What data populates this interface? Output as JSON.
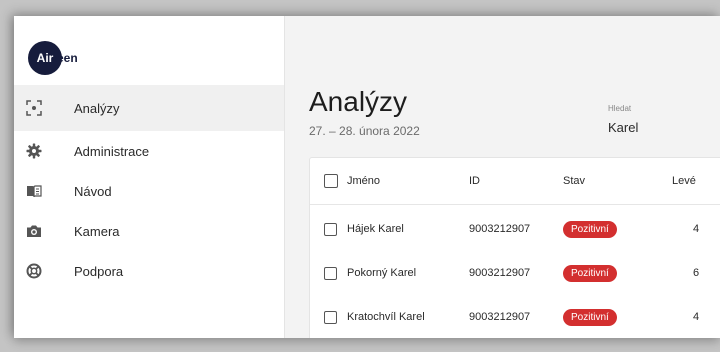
{
  "app": {
    "logo_badge": "Air",
    "logo_rest": "een"
  },
  "sidebar": {
    "items": [
      {
        "label": "Analýzy",
        "icon": "scan-focus-icon",
        "active": true
      },
      {
        "label": "Administrace",
        "icon": "gear-icon",
        "active": false
      },
      {
        "label": "Návod",
        "icon": "book-icon",
        "active": false
      },
      {
        "label": "Kamera",
        "icon": "camera-icon",
        "active": false
      },
      {
        "label": "Podpora",
        "icon": "lifebuoy-icon",
        "active": false
      }
    ]
  },
  "main": {
    "title": "Analýzy",
    "date_range": "27. – 28. února 2022",
    "search": {
      "label": "Hledat",
      "value": "Karel"
    }
  },
  "table": {
    "columns": [
      "Jméno",
      "ID",
      "Stav",
      "Levé"
    ],
    "rows": [
      {
        "name": "Hájek Karel",
        "id": "9003212907",
        "status": "Pozitivní",
        "left": "4"
      },
      {
        "name": "Pokorný Karel",
        "id": "9003212907",
        "status": "Pozitivní",
        "left": "6"
      },
      {
        "name": "Kratochvíl Karel",
        "id": "9003212907",
        "status": "Pozitivní",
        "left": "4"
      }
    ]
  },
  "colors": {
    "accent_dark": "#161c3c",
    "status_positive": "#d32f2f",
    "sidebar_active_bg": "#f0f0f0"
  }
}
